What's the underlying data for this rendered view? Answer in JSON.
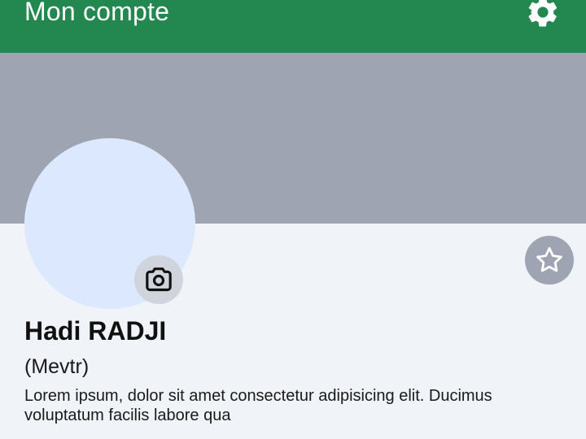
{
  "header": {
    "title": "Mon compte",
    "settings_icon": "gear-icon",
    "background_color": "#238850"
  },
  "profile": {
    "cover_color": "#9ea4b1",
    "avatar_color": "#dbe8fd",
    "camera_icon": "camera-icon",
    "favorite_icon": "star-icon",
    "name": "Hadi RADJI",
    "nickname": "(Mevtr)",
    "bio": "Lorem ipsum, dolor sit amet consectetur adipisicing elit. Ducimus voluptatum facilis labore qua"
  }
}
